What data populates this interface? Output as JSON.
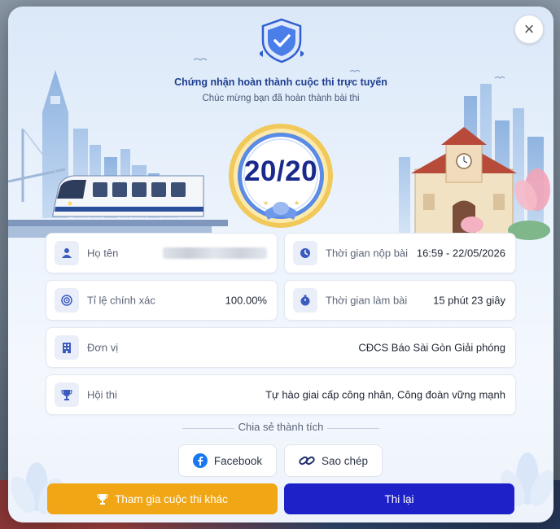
{
  "dialog": {
    "close_icon": "×",
    "title": "Chứng nhận hoàn thành cuộc thi trực tuyến",
    "subtitle": "Chúc mừng bạn đã hoàn thành bài thi",
    "score": "20/20"
  },
  "info": {
    "name": {
      "label": "Họ tên",
      "value_hidden": true
    },
    "submit_time": {
      "label": "Thời gian nộp bài",
      "value": "16:59 - 22/05/2026"
    },
    "accuracy": {
      "label": "Tỉ lệ chính xác",
      "value": "100.00%"
    },
    "duration": {
      "label": "Thời gian làm bài",
      "value": "15 phút 23 giây"
    },
    "unit": {
      "label": "Đơn vị",
      "value": "CĐCS Báo Sài Gòn Giải phóng"
    },
    "contest": {
      "label": "Hội thi",
      "value": "Tự hào giai cấp công nhân, Công đoàn vững mạnh"
    }
  },
  "share": {
    "title": "Chia sẻ thành tích",
    "facebook_label": "Facebook",
    "copy_label": "Sao chép"
  },
  "actions": {
    "other_contest_label": "Tham gia cuộc thi khác",
    "retry_label": "Thi lại"
  },
  "colors": {
    "primary_blue": "#1f21c8",
    "accent_orange": "#f0a615",
    "title_blue": "#1d3e8f",
    "score_navy": "#1a2a8c"
  },
  "icons": {
    "shield": "shield-check-icon",
    "name": "user-icon",
    "submit_time": "clock-icon",
    "accuracy": "target-icon",
    "duration": "stopwatch-icon",
    "unit": "building-icon",
    "contest": "trophy-icon",
    "facebook": "facebook-icon",
    "copy": "link-icon"
  }
}
